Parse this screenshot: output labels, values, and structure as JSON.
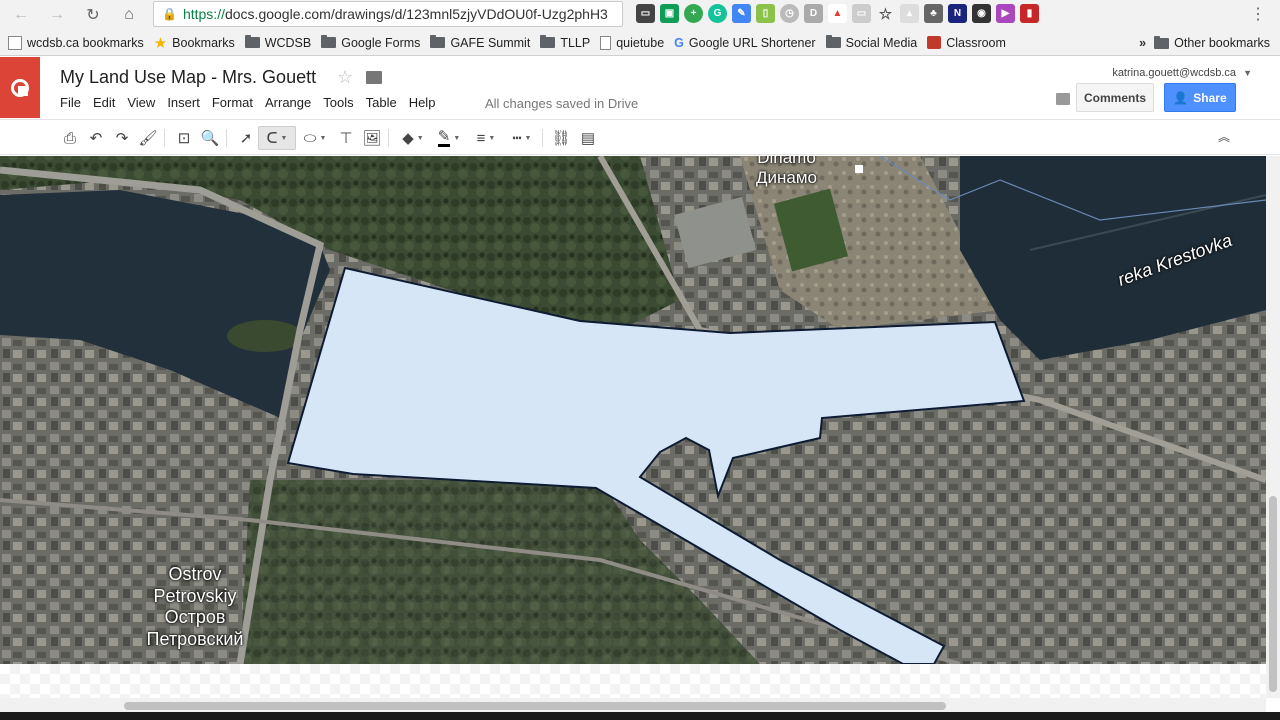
{
  "browser": {
    "url_https": "https://",
    "url_rest": "docs.google.com/drawings/d/123mnl5zjyVDdOU0f-Uzg2phH3",
    "bookmarks": [
      {
        "label": "wcdsb.ca bookmarks",
        "icon": "page-icon"
      },
      {
        "label": "Bookmarks",
        "icon": "star-icon"
      },
      {
        "label": "WCDSB",
        "icon": "folder-icon"
      },
      {
        "label": "Google Forms",
        "icon": "folder-icon"
      },
      {
        "label": "GAFE Summit",
        "icon": "folder-icon"
      },
      {
        "label": "TLLP",
        "icon": "folder-icon"
      },
      {
        "label": "quietube",
        "icon": "page-icon"
      },
      {
        "label": "Google URL Shortener",
        "icon": "google-icon"
      },
      {
        "label": "Social Media",
        "icon": "folder-icon"
      },
      {
        "label": "Classroom",
        "icon": "classroom-icon"
      }
    ],
    "more_bookmarks": "»",
    "other_bookmarks": "Other bookmarks"
  },
  "docs": {
    "title": "My Land Use Map - Mrs. Gouett",
    "menu": [
      "File",
      "Edit",
      "View",
      "Insert",
      "Format",
      "Arrange",
      "Tools",
      "Table",
      "Help"
    ],
    "save_status": "All changes saved in Drive",
    "account": "katrina.gouett@wcdsb.ca",
    "comments_label": "Comments",
    "share_label": "Share"
  },
  "map": {
    "labels": {
      "dinamo_latin": "Dinamo",
      "dinamo_cyrillic": "Динамо",
      "river": "reka Krestovka",
      "ostrov_latin_1": "Ostrov",
      "ostrov_latin_2": "Petrovskiy",
      "ostrov_cyr_1": "Остров",
      "ostrov_cyr_2": "Петровский"
    },
    "polygon_fill": "#d6e6f7",
    "polygon_stroke": "#0d1b33"
  }
}
